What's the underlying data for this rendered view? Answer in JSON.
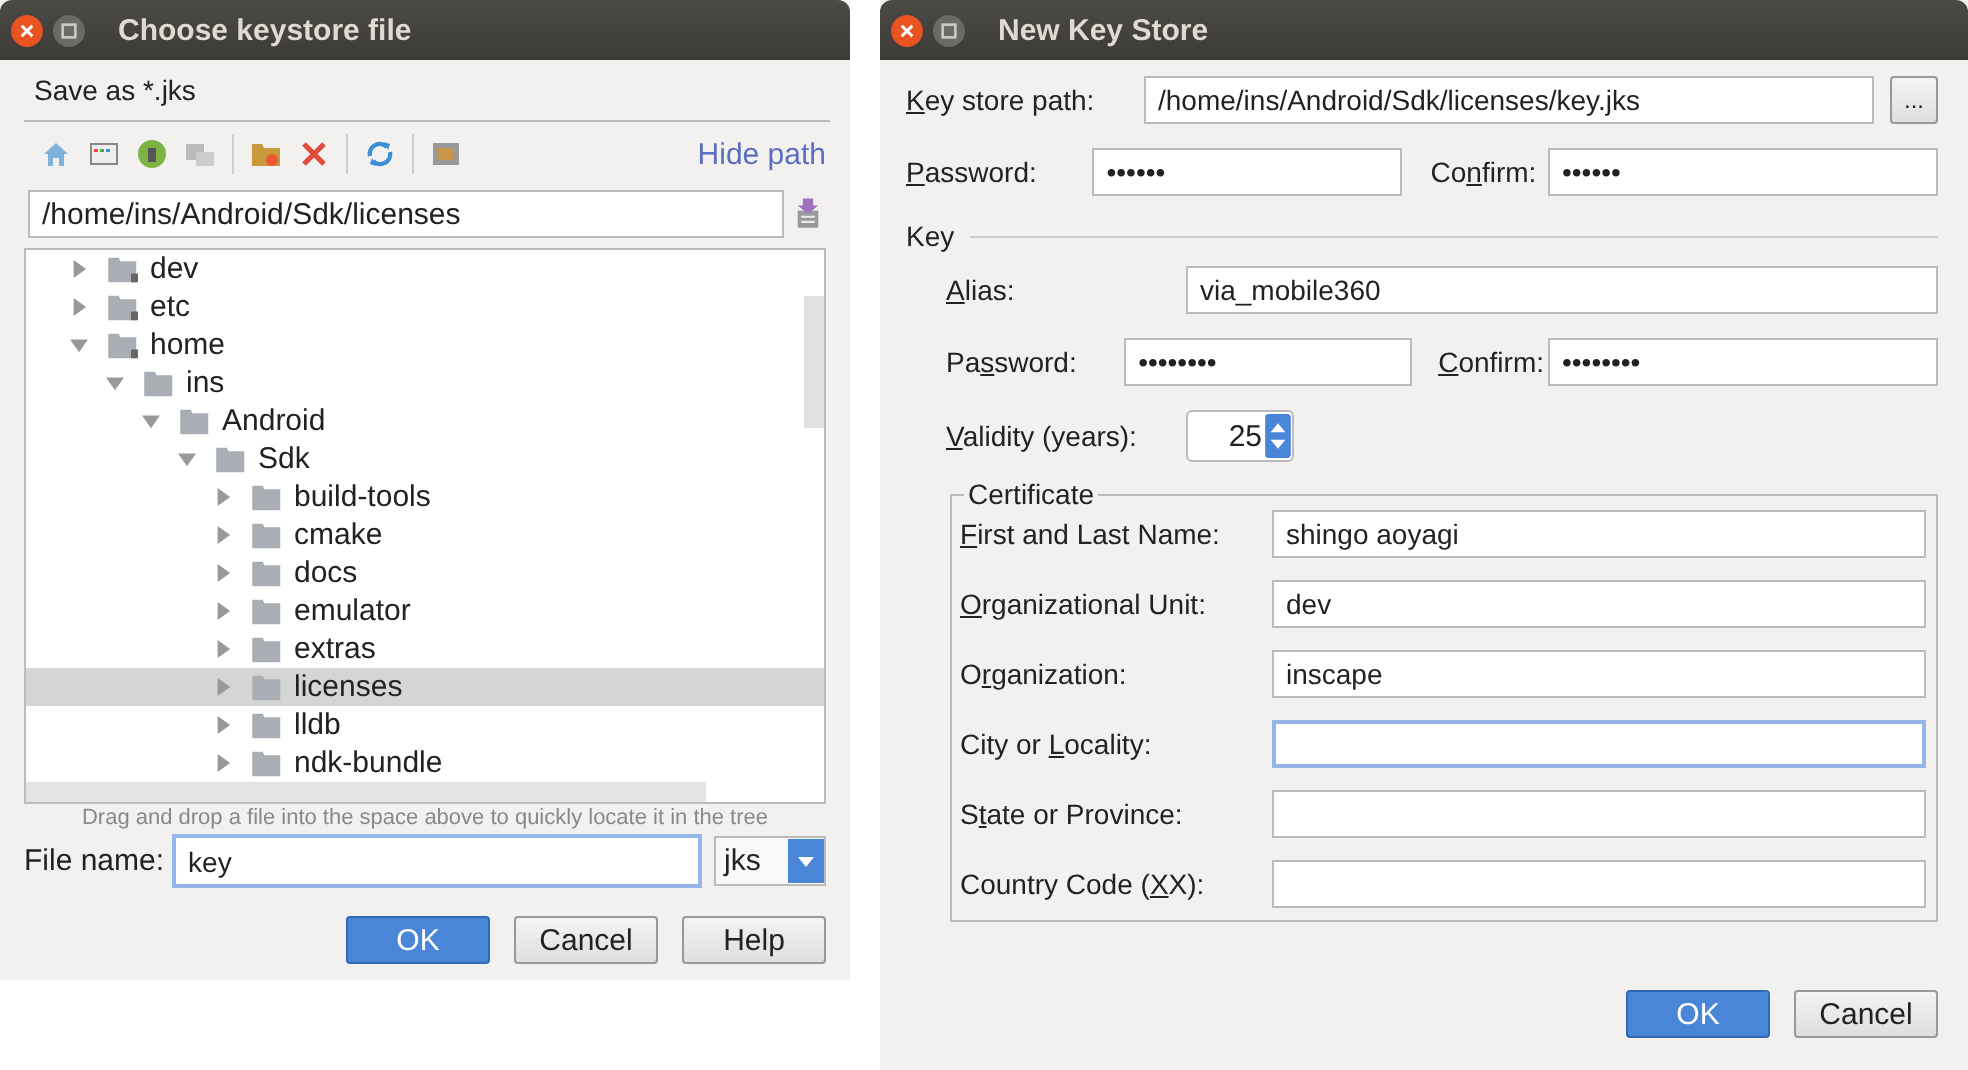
{
  "file_dialog": {
    "title": "Choose keystore file",
    "subtitle": "Save as *.jks",
    "hide_path_link": "Hide path",
    "path": "/home/ins/Android/Sdk/licenses",
    "tree": [
      {
        "label": "dev",
        "expanded": false,
        "selected": false,
        "locked": true
      },
      {
        "label": "etc",
        "expanded": false,
        "selected": false,
        "locked": true
      },
      {
        "label": "home",
        "expanded": true,
        "selected": false,
        "locked": true,
        "children": [
          {
            "label": "ins",
            "expanded": true,
            "selected": false,
            "locked": false,
            "children": [
              {
                "label": "Android",
                "expanded": true,
                "selected": false,
                "locked": false,
                "children": [
                  {
                    "label": "Sdk",
                    "expanded": true,
                    "selected": false,
                    "locked": false,
                    "children": [
                      {
                        "label": "build-tools",
                        "expanded": false,
                        "selected": false,
                        "locked": false
                      },
                      {
                        "label": "cmake",
                        "expanded": false,
                        "selected": false,
                        "locked": false
                      },
                      {
                        "label": "docs",
                        "expanded": false,
                        "selected": false,
                        "locked": false
                      },
                      {
                        "label": "emulator",
                        "expanded": false,
                        "selected": false,
                        "locked": false
                      },
                      {
                        "label": "extras",
                        "expanded": false,
                        "selected": false,
                        "locked": false
                      },
                      {
                        "label": "licenses",
                        "expanded": false,
                        "selected": true,
                        "locked": false
                      },
                      {
                        "label": "lldb",
                        "expanded": false,
                        "selected": false,
                        "locked": false
                      },
                      {
                        "label": "ndk-bundle",
                        "expanded": false,
                        "selected": false,
                        "locked": false
                      }
                    ]
                  }
                ]
              }
            ]
          }
        ]
      }
    ],
    "drop_hint": "Drag and drop a file into the space above to quickly locate it in the tree",
    "file_name_label": "File name:",
    "file_name": {
      "value": "key",
      "focused": true
    },
    "file_type": "jks",
    "buttons": [
      {
        "label": "OK",
        "default": true
      },
      {
        "label": "Cancel",
        "default": false
      },
      {
        "label": "Help",
        "default": false
      }
    ]
  },
  "keystore_dialog": {
    "title": "New Key Store",
    "path_label": {
      "mnemonic": "K",
      "after": "ey store path:"
    },
    "path": {
      "value": "/home/ins/Android/Sdk/licenses/key.jks",
      "focused": false
    },
    "browse_button": "...",
    "password_label": {
      "mnemonic": "P",
      "after": "assword:"
    },
    "password": {
      "value": "••••••",
      "focused": false
    },
    "confirm_label": {
      "before": "Co",
      "mnemonic": "n",
      "after": "firm:"
    },
    "confirm": {
      "value": "••••••",
      "focused": false
    },
    "key_section": "Key",
    "alias_label": {
      "mnemonic": "A",
      "after": "lias:"
    },
    "alias": {
      "value": "via_mobile360",
      "focused": false
    },
    "key_password_label": {
      "before": "Pa",
      "mnemonic": "s",
      "after": "sword:"
    },
    "key_password": {
      "value": "••••••••",
      "focused": false
    },
    "key_confirm_label": {
      "mnemonic": "C",
      "after": "onfirm:"
    },
    "key_confirm": {
      "value": "••••••••",
      "focused": false
    },
    "validity_label": {
      "mnemonic": "V",
      "after": "alidity (years):"
    },
    "validity": "25",
    "certificate_title": "Certificate",
    "certificate": [
      {
        "label": {
          "mnemonic": "F",
          "after": "irst and Last Name:"
        },
        "value": "shingo aoyagi",
        "focused": false
      },
      {
        "label": {
          "mnemonic": "O",
          "after": "rganizational Unit:"
        },
        "value": "dev",
        "focused": false
      },
      {
        "label": {
          "before": "O",
          "mnemonic": "r",
          "after": "ganization:"
        },
        "value": "inscape",
        "focused": false
      },
      {
        "label": {
          "before": "City or ",
          "mnemonic": "L",
          "after": "ocality:"
        },
        "focused": true
      },
      {
        "label": {
          "before": "S",
          "mnemonic": "t",
          "after": "ate or Province:"
        },
        "focused": false
      },
      {
        "label": {
          "before": "Country Code (",
          "mnemonic": "X",
          "after": "X):"
        },
        "focused": false
      }
    ],
    "buttons": [
      {
        "label": "OK",
        "default": true
      },
      {
        "label": "Cancel",
        "default": false
      }
    ]
  }
}
